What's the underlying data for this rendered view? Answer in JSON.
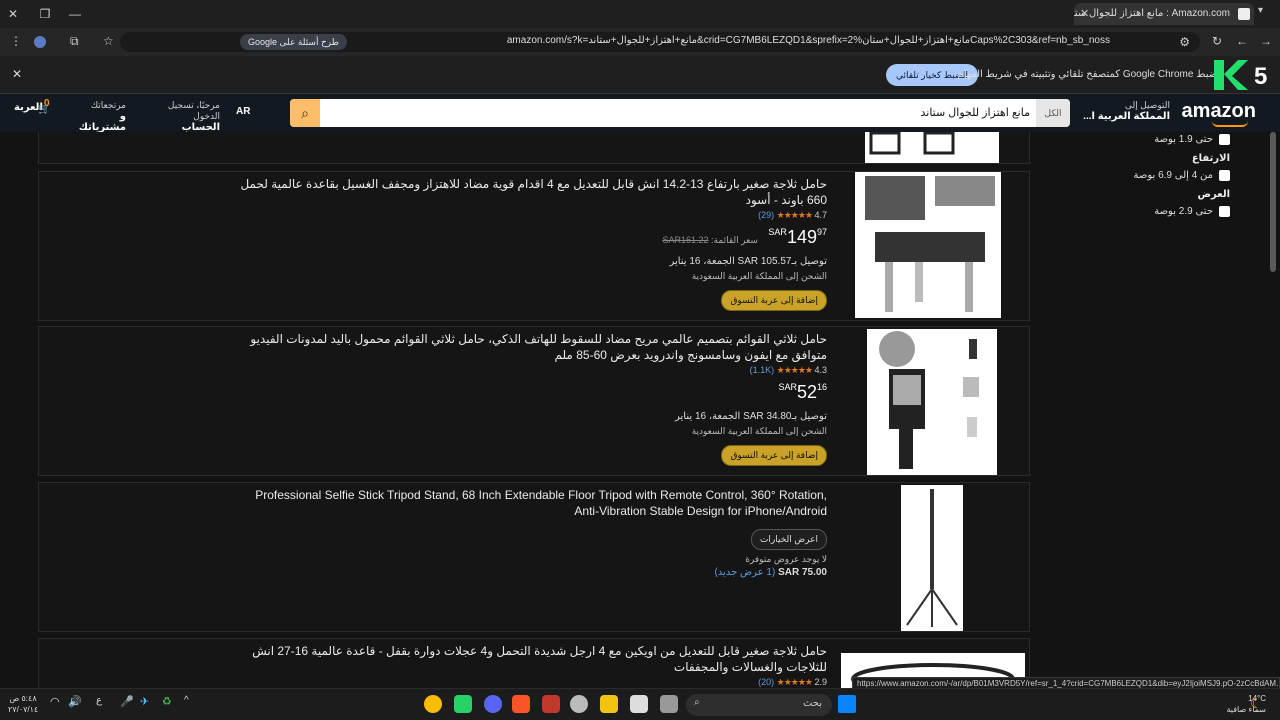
{
  "browser": {
    "tab_title": "Amazon.com : مانع اهتزاز للجوال ستاند",
    "tab_close": "✕",
    "new_tab": "+",
    "url": "amazon.com/s?k=مانع+اهتزاز+للجوال+ستاند&crid=CG7MB6LEZQD1&sprefix=مانع+اهتزاز+للجوال+ستان%2Caps%2C303&ref=nb_sb_noss",
    "google_pill": "طرح أسئلة على Google",
    "infobar_text": "اضبط Google Chrome كمتصفح تلقائي وتثبيته في شريط المهام",
    "infobar_button": "الضبط كخيار تلقائي",
    "infobar_close": "✕",
    "status_url": "https://www.amazon.com/-/ar/dp/B01M3VRD5Y/ref=sr_1_4?crid=CG7MB6LEZQD1&dib=eyJ2IjoiMSJ9.pO-2zCcBdAM..."
  },
  "amazon": {
    "logo": "amazon",
    "deliver_label": "التوصيل إلى",
    "deliver_location": "المملكة العربية ا...",
    "search_category": "الكل",
    "search_query": "مانع اهتزاز للجوال ستاند",
    "lang": "AR",
    "account_greeting": "مرحبًا، تسجيل الدخول",
    "account_label": "الحساب والقوائم",
    "orders_label1": "مرتجعاتك",
    "orders_label2": "و مشترياتك",
    "cart_label": "العربة",
    "cart_count": "0"
  },
  "filters": [
    {
      "heading": "",
      "option": "حتى 1.9 بوصة"
    },
    {
      "heading": "الارتفاع",
      "option": "من 4 إلى 6.9 بوصة"
    },
    {
      "heading": "العرض",
      "option": "حتى 2.9 بوصة"
    }
  ],
  "products": [
    {
      "title": "حامل ثلاجة صغير بارتفاع 13-14.2 انش قابل للتعديل مع 4 اقدام قوية مضاد للاهتزاز ومجفف الغسيل بقاعدة عالمية لحمل 660 باوند - أسود",
      "rating": "4.7",
      "stars": "★★★★★",
      "count": "(29)",
      "currency": "SAR",
      "whole": "149",
      "frac": "97",
      "was_label": "سعر القائمة:",
      "was_price": "SAR161.22",
      "delivery": "توصيل بـ105.57 SAR الجمعة، 16 يناير",
      "shipto": "الشحن إلى المملكة العربية السعودية",
      "button": "إضافة إلى عربة التسوق"
    },
    {
      "title": "حامل ثلاثي القوائم بتصميم عالمي مريح مضاد للسقوط للهاتف الذكي، حامل ثلاثي القوائم محمول باليد لمدونات الفيديو متوافق مع ايفون وسامسونج واندرويد بعرض 60-85 ملم",
      "rating": "4.3",
      "stars": "★★★★★",
      "count": "(1.1K)",
      "currency": "SAR",
      "whole": "52",
      "frac": "16",
      "delivery": "توصيل بـ34.80 SAR الجمعة، 16 يناير",
      "shipto": "الشحن إلى المملكة العربية السعودية",
      "button": "إضافة إلى عربة التسوق"
    },
    {
      "title": "Professional Selfie Stick Tripod Stand, 68 Inch Extendable Floor Tripod with Remote Control, 360° Rotation, Anti-Vibration Stable Design for iPhone/Android",
      "button": "اعرض الخيارات",
      "no_offer": "لا يوجد عروض متوفرة",
      "offer_price": "SAR 75.00",
      "offer_count": "(1 عرض جديد)"
    },
    {
      "title": "حامل ثلاجة صغير قابل للتعديل من اويكين مع 4 ارجل شديدة التحمل و4 عجلات دوارة بقفل - قاعدة عالمية 16-27 انش للثلاجات والغسالات والمجففات",
      "rating": "2.9",
      "stars": "★★★★★",
      "count": "(20)"
    }
  ],
  "taskbar": {
    "search": "بحث",
    "time": "٥:٤٨ ص",
    "date": "٢٧/٠٧/١٤",
    "weather_temp": "14°C",
    "weather_desc": "سماء صافية"
  }
}
